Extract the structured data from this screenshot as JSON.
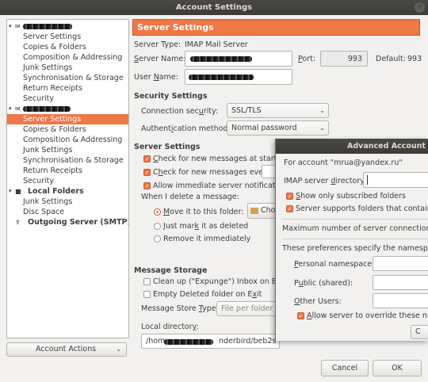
{
  "window": {
    "title": "Account Settings",
    "close": "×"
  },
  "tree": {
    "account1_items": [
      "Server Settings",
      "Copies & Folders",
      "Composition & Addressing",
      "Junk Settings",
      "Synchronisation & Storage",
      "Return Receipts",
      "Security"
    ],
    "account2_items": [
      "Server Settings",
      "Copies & Folders",
      "Composition & Addressing",
      "Junk Settings",
      "Synchronisation & Storage",
      "Return Receipts",
      "Security"
    ],
    "local_folders": "Local Folders",
    "local_items": [
      "Junk Settings",
      "Disc Space"
    ],
    "outgoing": "Outgoing Server (SMTP)"
  },
  "account_actions": "Account Actions",
  "main": {
    "header": "Server Settings",
    "server_type_label": "Server Type:",
    "server_type_value": "IMAP Mail Server",
    "server_name_label": "Server Name:",
    "port_label": "Port:",
    "port_value": "993",
    "default_label": "Default:",
    "default_value": "993",
    "user_name_label": "User Name:",
    "security_section": "Security Settings",
    "conn_security_label": "Connection security:",
    "conn_security_value": "SSL/TLS",
    "auth_label": "Authentication method:",
    "auth_value": "Normal password",
    "server_section": "Server Settings",
    "check_startup": "Check for new messages at startup",
    "check_every": "Check for new messages every",
    "allow_immediate": "Allow immediate server notifications",
    "when_delete": "When I delete a message:",
    "move_to": "Move it to this folder:",
    "choose_btn": "Choo",
    "just_mark": "Just mark it as deleted",
    "remove_immediately": "Remove it immediately",
    "storage_section": "Message Storage",
    "clean_up": "Clean up (\"Expunge\") Inbox on Exit",
    "empty_deleted": "Empty Deleted folder on Exit",
    "store_type_label": "Message Store Type:",
    "store_type_value": "File per folder (",
    "local_dir_label": "Local directory:",
    "local_dir_prefix": "/hom",
    "local_dir_mid": "nderbird/beb2s"
  },
  "advanced": {
    "title": "Advanced Account Se",
    "for_account": "For account \"mrua@yandex.ru\"",
    "imap_dir_label": "IMAP server directory:",
    "show_subscribed": "Show only subscribed folders",
    "supports_folders": "Server supports folders that contain sub",
    "max_conn": "Maximum number of server connections to",
    "prefs_namespaces": "These preferences specify the namespaces",
    "personal": "Personal namespace:",
    "public": "Public (shared):",
    "other": "Other Users:",
    "allow_override": "Allow server to override these name",
    "c_btn": "C"
  },
  "footer": {
    "cancel": "Cancel",
    "ok": "OK"
  },
  "colors": {
    "accent": "#f07746",
    "titlebar": "#3c3b37"
  }
}
